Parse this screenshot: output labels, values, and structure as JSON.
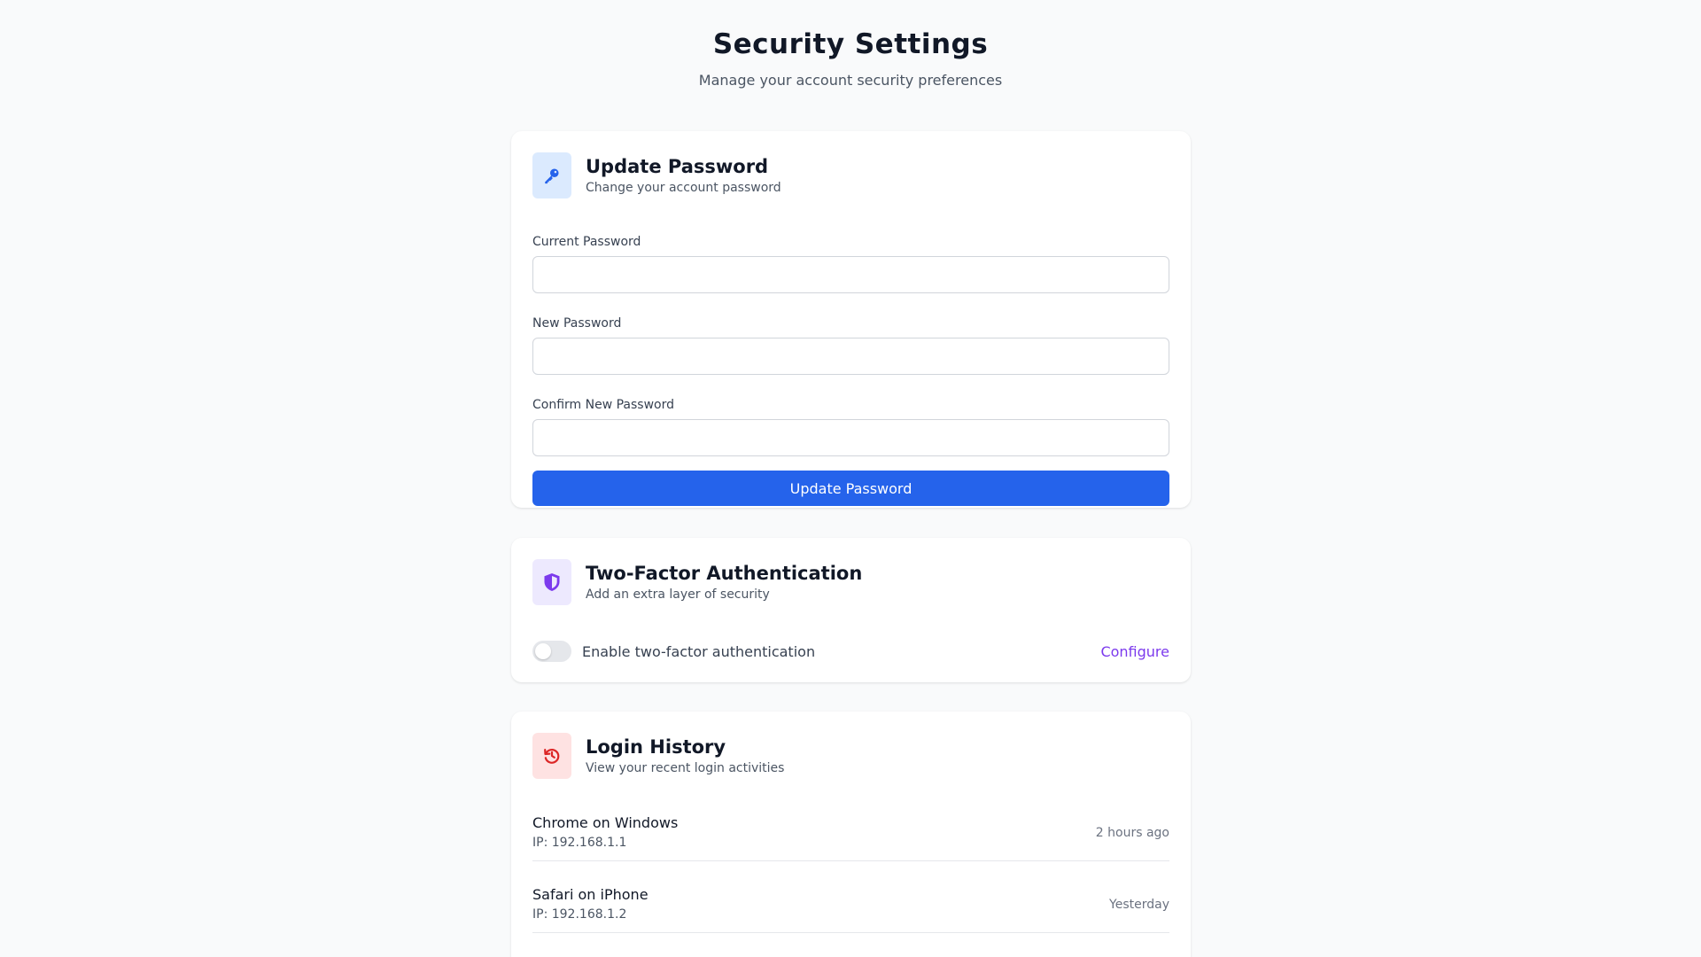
{
  "header": {
    "title": "Security Settings",
    "subtitle": "Manage your account security preferences"
  },
  "password_card": {
    "icon": "key-icon",
    "title": "Update Password",
    "description": "Change your account password",
    "fields": [
      {
        "label": "Current Password",
        "value": "",
        "placeholder": ""
      },
      {
        "label": "New Password",
        "value": "",
        "placeholder": ""
      },
      {
        "label": "Confirm New Password",
        "value": "",
        "placeholder": ""
      }
    ],
    "submit_label": "Update Password"
  },
  "two_factor_card": {
    "icon": "shield-icon",
    "title": "Two-Factor Authentication",
    "description": "Add an extra layer of security",
    "toggle_label": "Enable two-factor authentication",
    "toggle_enabled": false,
    "configure_label": "Configure"
  },
  "history_card": {
    "icon": "history-icon",
    "title": "Login History",
    "description": "View your recent login activities",
    "entries": [
      {
        "device": "Chrome on Windows",
        "ip": "IP: 192.168.1.1",
        "time": "2 hours ago"
      },
      {
        "device": "Safari on iPhone",
        "ip": "IP: 192.168.1.2",
        "time": "Yesterday"
      }
    ]
  },
  "colors": {
    "primary": "#2563eb",
    "accent_purple": "#7c3aed",
    "accent_red": "#dc2626",
    "background": "#f9fafb"
  }
}
